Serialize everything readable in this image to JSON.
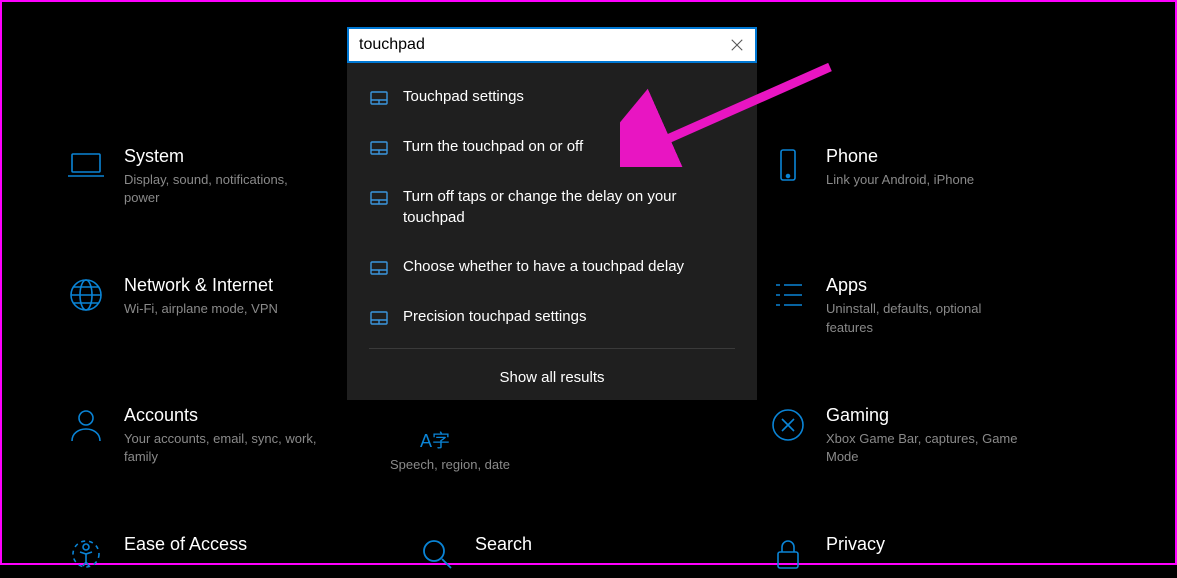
{
  "search": {
    "value": "touchpad",
    "close_title": "Clear"
  },
  "results": [
    {
      "label": "Touchpad settings"
    },
    {
      "label": "Turn the touchpad on or off"
    },
    {
      "label": "Turn off taps or change the delay on your touchpad"
    },
    {
      "label": "Choose whether to have a touchpad delay"
    },
    {
      "label": "Precision touchpad settings"
    }
  ],
  "show_all": "Show all results",
  "categories": {
    "system": {
      "title": "System",
      "desc": "Display, sound, notifications, power"
    },
    "phone": {
      "title": "Phone",
      "desc": "Link your Android, iPhone"
    },
    "network": {
      "title": "Network & Internet",
      "desc": "Wi-Fi, airplane mode, VPN"
    },
    "apps": {
      "title": "Apps",
      "desc": "Uninstall, defaults, optional features"
    },
    "accounts": {
      "title": "Accounts",
      "desc": "Your accounts, email, sync, work, family"
    },
    "gaming": {
      "title": "Gaming",
      "desc": "Xbox Game Bar, captures, Game Mode"
    },
    "ease": {
      "title": "Ease of Access",
      "desc": ""
    },
    "searchcat": {
      "title": "Search",
      "desc": ""
    },
    "privacy": {
      "title": "Privacy",
      "desc": ""
    }
  },
  "peek": {
    "icon_label": "A字",
    "desc": "Speech, region, date"
  }
}
